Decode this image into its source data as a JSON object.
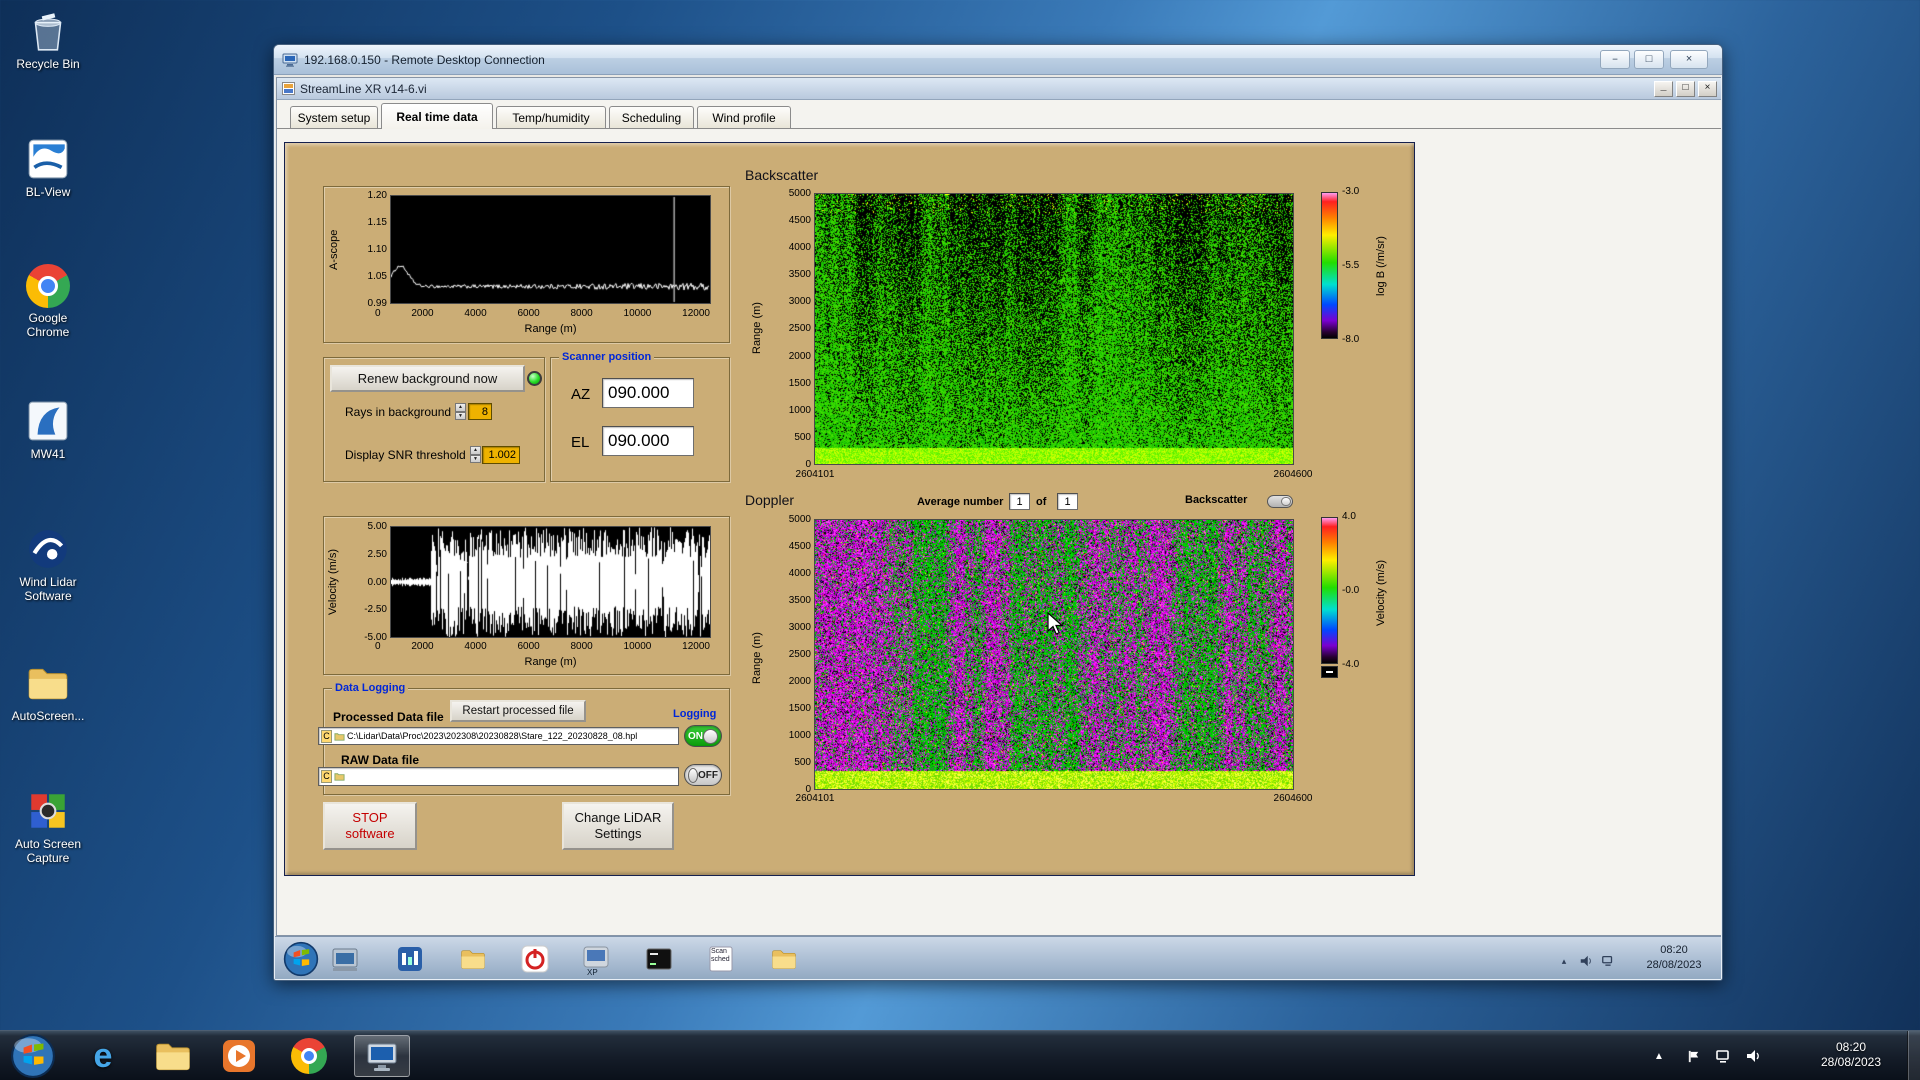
{
  "desktop": {
    "icons": [
      {
        "label": "Recycle Bin"
      },
      {
        "label": "BL-View"
      },
      {
        "label": "Google Chrome"
      },
      {
        "label": "MW41"
      },
      {
        "label": "Wind Lidar Software"
      },
      {
        "label": "AutoScreen..."
      },
      {
        "label": "Auto Screen Capture"
      }
    ]
  },
  "rdp": {
    "title": "192.168.0.150 - Remote Desktop Connection",
    "buttons": {
      "minimize": "–",
      "maximize": "□",
      "close": "×"
    }
  },
  "labview": {
    "title": "StreamLine XR v14-6.vi",
    "buttons": {
      "minimize": "_",
      "restore": "□",
      "close": "×"
    },
    "tabs": [
      "System setup",
      "Real time data",
      "Temp/humidity",
      "Scheduling",
      "Wind profile"
    ],
    "active_tab": "Real time data"
  },
  "panel": {
    "renew_button": "Renew background now",
    "rays_label": "Rays in background",
    "rays_value": "8",
    "snr_label": "Display SNR threshold",
    "snr_value": "1.002",
    "scanner": {
      "title": "Scanner position",
      "az_label": "AZ",
      "az_value": "090.000",
      "el_label": "EL",
      "el_value": "090.000"
    },
    "average_label": "Average number",
    "average_value": "1",
    "of_label": "of",
    "of_total": "1",
    "backscatter_toggle_label": "Backscatter",
    "logging": {
      "group_title": "Data Logging",
      "processed_label": "Processed Data file",
      "restart_button": "Restart processed file",
      "logging_label": "Logging",
      "drive_letter": "C",
      "processed_path": "C:\\Lidar\\Data\\Proc\\2023\\202308\\20230828\\Stare_122_20230828_08.hpl",
      "raw_label": "RAW Data file",
      "raw_path": "",
      "on_label": "ON",
      "off_label": "OFF"
    },
    "stop_button_line1": "STOP",
    "stop_button_line2": "software",
    "settings_button_line1": "Change LiDAR",
    "settings_button_line2": "Settings"
  },
  "remote_taskbar": {
    "time": "08:20",
    "date": "28/08/2023",
    "xp_label": "XP",
    "scan_label": "Scan",
    "sched_label": "sched"
  },
  "host_taskbar": {
    "time": "08:20",
    "date": "28/08/2023"
  },
  "chart_data": [
    {
      "id": "ascope",
      "type": "line",
      "title": "A-scope signal vs range",
      "ylabel": "A-scope",
      "xlabel": "Range (m)",
      "ylim": [
        0.99,
        1.2
      ],
      "xlim": [
        0,
        12000
      ],
      "yticks": [
        "1.20",
        "1.15",
        "1.10",
        "1.05",
        "0.99"
      ],
      "xticks": [
        "0",
        "2000",
        "4000",
        "6000",
        "8000",
        "10000",
        "12000"
      ],
      "bg": "#000000",
      "line_color": "#ffffff",
      "gen": {
        "baseline": 1.021,
        "noise": 0.005,
        "peak_x": 350,
        "peak_sigma": 420,
        "peak_value": 1.062,
        "spike_x": 10650
      }
    },
    {
      "id": "backscatter",
      "type": "heatmap",
      "title": "Backscatter",
      "ylabel": "Range (m)",
      "yticks": [
        "5000",
        "4500",
        "4000",
        "3500",
        "3000",
        "2500",
        "2000",
        "1500",
        "1000",
        "500",
        "0"
      ],
      "xtick_left": "2604101",
      "xtick_right": "2604600",
      "colorbar": {
        "label": "log B (/m/sr)",
        "ticks": [
          "-3.0",
          "-5.5",
          "-8.0"
        ]
      },
      "gen": {
        "mode": "backscatter",
        "greens": [
          "#1ecc00",
          "#35d400",
          "#0fb600",
          "#4ae000"
        ],
        "speck": "#f5ff00",
        "bottom": [
          "#a6ff00",
          "#7dff00",
          "#d2ff00",
          "#5bee00"
        ]
      }
    },
    {
      "id": "velocity",
      "type": "line-dense",
      "title": "Velocity vs range",
      "ylabel": "Velocity (m/s)",
      "xlabel": "Range (m)",
      "ylim": [
        -5,
        5
      ],
      "xlim": [
        0,
        12000
      ],
      "yticks": [
        "5.00",
        "2.50",
        "0.00",
        "-2.50",
        "-5.00"
      ],
      "xticks": [
        "0",
        "2000",
        "4000",
        "6000",
        "8000",
        "10000",
        "12000"
      ],
      "bg": "#000000",
      "line_color": "#ffffff",
      "gen": {
        "flat_until": 1500
      }
    },
    {
      "id": "doppler",
      "type": "heatmap",
      "title": "Doppler",
      "ylabel": "Range (m)",
      "yticks": [
        "5000",
        "4500",
        "4000",
        "3500",
        "3000",
        "2500",
        "2000",
        "1500",
        "1000",
        "500",
        "0"
      ],
      "xtick_left": "2604101",
      "xtick_right": "2604600",
      "colorbar": {
        "label": "Velocity (m/s)",
        "ticks": [
          "4.0",
          "-0.0",
          "-4.0"
        ]
      },
      "gen": {
        "mode": "doppler",
        "magenta": [
          "#ff00ff",
          "#e000e6",
          "#b400cc",
          "#ff46ff",
          "#9000aa"
        ],
        "green": [
          "#00cc00",
          "#00e400",
          "#009e00"
        ],
        "specks": [
          "#ffff00",
          "#ff3000",
          "#3048ff"
        ],
        "bottom": [
          "#d2ff00",
          "#a0ee00",
          "#ffff46",
          "#6cdc00"
        ]
      }
    }
  ]
}
